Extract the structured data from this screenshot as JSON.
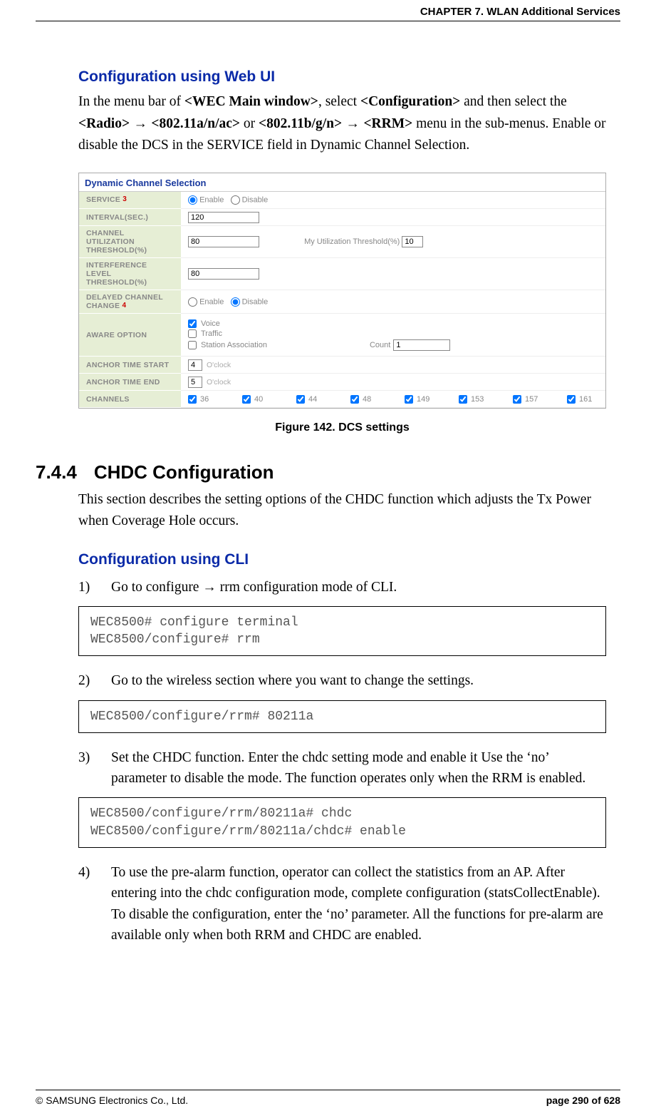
{
  "header": {
    "chapter": "CHAPTER 7. WLAN Additional Services"
  },
  "h_web": "Configuration using Web UI",
  "p_web": {
    "t1": "In the menu bar of ",
    "b1": "<WEC Main window>",
    "t2": ", select ",
    "b2": "<Configuration>",
    "t3": " and then select the ",
    "b3": "<Radio>",
    "arr": " → ",
    "b4": "<802.11a/n/ac>",
    "t4": " or ",
    "b5": "<802.11b/g/n>",
    "b6": "<RRM>",
    "t5": " menu in the sub-menus. Enable or disable the DCS in the SERVICE field in Dynamic Channel Selection."
  },
  "dcs": {
    "title": "Dynamic Channel Selection",
    "labels": {
      "service": "SERVICE",
      "sup3": "3",
      "interval": "INTERVAL(SEC.)",
      "cut": "CHANNEL UTILIZATION THRESHOLD(%)",
      "ilt": "INTERFERENCE LEVEL THRESHOLD(%)",
      "dcc": "DELAYED CHANNEL CHANGE",
      "sup4": "4",
      "aware": "AWARE OPTION",
      "ats": "ANCHOR TIME START",
      "ate": "ANCHOR TIME END",
      "channels": "CHANNELS"
    },
    "vals": {
      "enable": "Enable",
      "disable": "Disable",
      "interval": "120",
      "cut": "80",
      "myut": "My Utilization Threshold(%)",
      "myut_v": "10",
      "ilt": "80",
      "voice": "Voice",
      "traffic": "Traffic",
      "sa": "Station Association",
      "count": "Count",
      "count_v": "1",
      "ats": "4",
      "ate": "5",
      "oclock": "O'clock",
      "ch": [
        "36",
        "40",
        "44",
        "48",
        "149",
        "153",
        "157",
        "161"
      ]
    }
  },
  "fig_caption": "Figure 142. DCS settings",
  "sec": {
    "num": "7.4.4",
    "title": "CHDC Configuration"
  },
  "p_chdc": "This section describes the setting options of the CHDC function which adjusts the Tx Power when Coverage Hole occurs.",
  "h_cli": "Configuration using CLI",
  "steps": {
    "s1": {
      "n": "1)",
      "t": "Go to configure → rrm configuration mode of CLI."
    },
    "s2": {
      "n": "2)",
      "t": "Go to the wireless section where you want to change the settings."
    },
    "s3": {
      "n": "3)",
      "t": "Set the CHDC function. Enter the chdc setting mode and enable it Use the ‘no’ parameter to disable the mode. The function operates only when the RRM is enabled."
    },
    "s4": {
      "n": "4)",
      "t": "To use the pre-alarm function, operator can collect the statistics from an AP. After entering into the chdc configuration mode, complete configuration (statsCollectEnable). To disable the configuration, enter the ‘no’ parameter. All the functions for pre-alarm are available only when both RRM and CHDC are enabled."
    }
  },
  "code": {
    "c1": "WEC8500# configure terminal \nWEC8500/configure# rrm ",
    "c2": "WEC8500/configure/rrm# 80211a ",
    "c3": "WEC8500/configure/rrm/80211a# chdc \nWEC8500/configure/rrm/80211a/chdc# enable "
  },
  "footer": {
    "left": "© SAMSUNG Electronics Co., Ltd.",
    "right": "page 290 of 628"
  }
}
